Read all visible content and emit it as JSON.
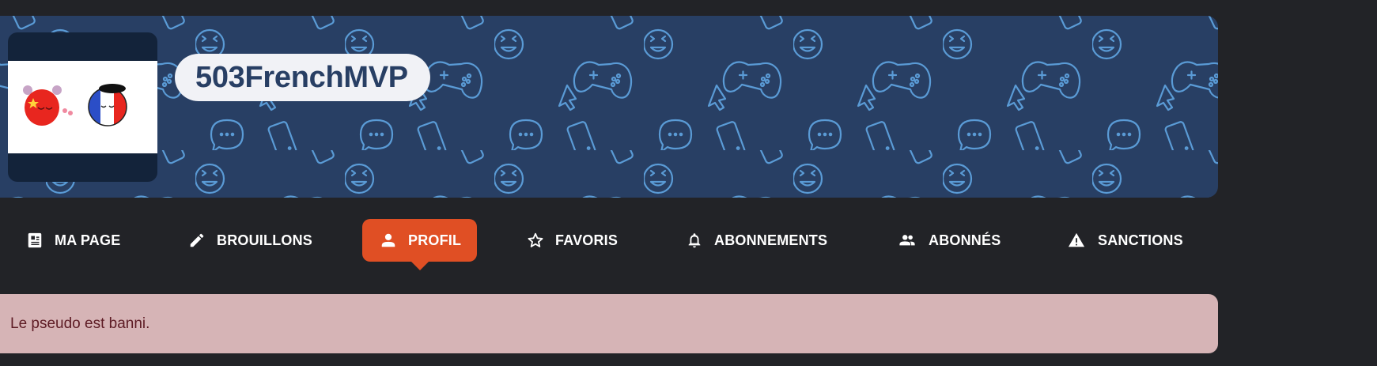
{
  "profile": {
    "username": "503FrenchMVP"
  },
  "nav": {
    "tabs": [
      {
        "label": "MA PAGE",
        "icon": "page-icon",
        "active": false
      },
      {
        "label": "BROUILLONS",
        "icon": "pencil-icon",
        "active": false
      },
      {
        "label": "PROFIL",
        "icon": "person-icon",
        "active": true
      },
      {
        "label": "FAVORIS",
        "icon": "star-icon",
        "active": false
      },
      {
        "label": "ABONNEMENTS",
        "icon": "bell-icon",
        "active": false
      },
      {
        "label": "ABONNÉS",
        "icon": "people-icon",
        "active": false
      },
      {
        "label": "SANCTIONS",
        "icon": "warning-icon",
        "active": false
      }
    ]
  },
  "alert": {
    "message": "Le pseudo est banni."
  },
  "colors": {
    "background": "#222327",
    "banner": "#283f64",
    "banner_pattern": "#5a9bd6",
    "accent": "#e04f24",
    "alert_background": "#d6b4b6",
    "alert_text": "#5d1b24"
  }
}
